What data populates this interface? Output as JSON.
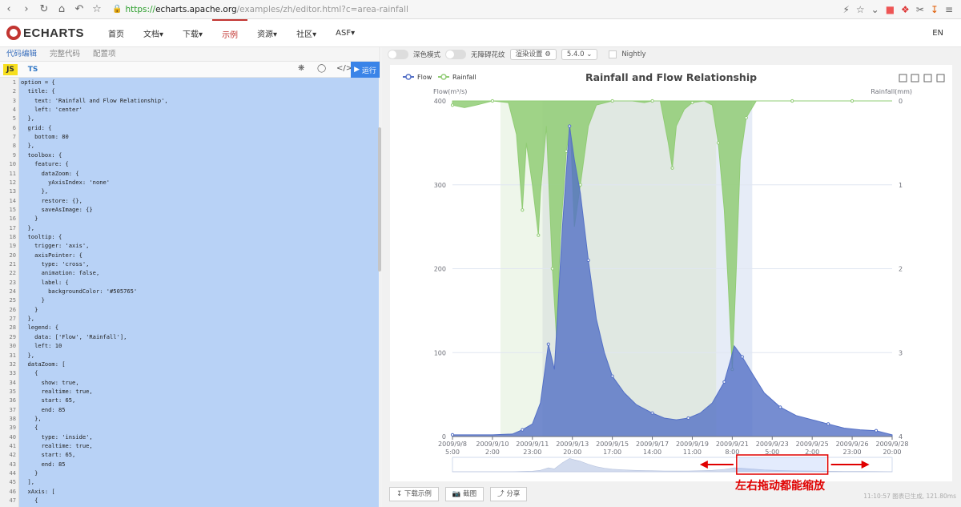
{
  "browser": {
    "url_scheme": "https://",
    "url_host": "echarts.apache.org",
    "url_path": "/examples/zh/editor.html?c=area-rainfall"
  },
  "site": {
    "brand": "ECHARTS",
    "nav": [
      "首页",
      "文档▾",
      "下载▾",
      "示例",
      "资源▾",
      "社区▾",
      "ASF▾"
    ],
    "lang": "EN"
  },
  "editor": {
    "tabs": [
      "代码编辑",
      "完整代码",
      "配置项"
    ],
    "js": "JS",
    "ts": "TS",
    "run": "运行",
    "code_lines": [
      "option = {",
      "  title: {",
      "    text: 'Rainfall and Flow Relationship',",
      "    left: 'center'",
      "  },",
      "  grid: {",
      "    bottom: 80",
      "  },",
      "  toolbox: {",
      "    feature: {",
      "      dataZoom: {",
      "        yAxisIndex: 'none'",
      "      },",
      "      restore: {},",
      "      saveAsImage: {}",
      "    }",
      "  },",
      "  tooltip: {",
      "    trigger: 'axis',",
      "    axisPointer: {",
      "      type: 'cross',",
      "      animation: false,",
      "      label: {",
      "        backgroundColor: '#505765'",
      "      }",
      "    }",
      "  },",
      "  legend: {",
      "    data: ['Flow', 'Rainfall'],",
      "    left: 10",
      "  },",
      "  dataZoom: [",
      "    {",
      "      show: true,",
      "      realtime: true,",
      "      start: 65,",
      "      end: 85",
      "    },",
      "    {",
      "      type: 'inside',",
      "      realtime: true,",
      "      start: 65,",
      "      end: 85",
      "    }",
      "  ],",
      "  xAxis: [",
      "    {"
    ]
  },
  "controls": {
    "dark": "深色模式",
    "noblur": "无障碍花纹",
    "render": "渲染设置 ⚙",
    "version": "5.4.0",
    "nightly": "Nightly"
  },
  "bottom": {
    "download": "下载示例",
    "screenshot": "截图",
    "share": "分享",
    "timestamp": "11:10:57  图表已生成, 121.80ms"
  },
  "annotation": "左右拖动都能缩放",
  "colors": {
    "flow": "#5470c6",
    "rainfall": "#91cc75",
    "accent": "#c23531",
    "mark1": "#f0f7ec",
    "mark2": "#e4ebe4",
    "mark3": "#e8edf7"
  },
  "chart_data": {
    "type": "area",
    "title": "Rainfall and Flow Relationship",
    "legend": [
      "Flow",
      "Rainfall"
    ],
    "yaxis_left": {
      "name": "Flow(m³/s)",
      "range": [
        0,
        400
      ],
      "ticks": [
        "0",
        "100",
        "200",
        "300",
        "400"
      ]
    },
    "yaxis_right": {
      "name": "Rainfall(mm)",
      "range": [
        0,
        4
      ],
      "inverse": true,
      "ticks": [
        "0",
        "1",
        "2",
        "3",
        "4"
      ]
    },
    "x_ticks": [
      "2009/9/8\n5:00",
      "2009/9/10\n2:00",
      "2009/9/11\n23:00",
      "2009/9/13\n20:00",
      "2009/9/15\n17:00",
      "2009/9/17\n14:00",
      "2009/9/19\n11:00",
      "2009/9/21\n8:00",
      "2009/9/23\n5:00",
      "2009/9/25\n2:00",
      "2009/9/26\n23:00",
      "2009/9/28\n20:00"
    ],
    "x_range": [
      0,
      11
    ],
    "series": [
      {
        "name": "Flow",
        "points": [
          [
            0,
            2
          ],
          [
            1,
            2
          ],
          [
            1.5,
            3
          ],
          [
            1.75,
            8
          ],
          [
            2,
            15
          ],
          [
            2.2,
            40
          ],
          [
            2.4,
            110
          ],
          [
            2.55,
            80
          ],
          [
            2.75,
            250
          ],
          [
            2.93,
            370
          ],
          [
            3.05,
            330
          ],
          [
            3.2,
            290
          ],
          [
            3.4,
            210
          ],
          [
            3.6,
            140
          ],
          [
            3.8,
            100
          ],
          [
            4,
            72
          ],
          [
            4.3,
            52
          ],
          [
            4.6,
            38
          ],
          [
            5,
            28
          ],
          [
            5.3,
            22
          ],
          [
            5.6,
            20
          ],
          [
            5.9,
            22
          ],
          [
            6.2,
            28
          ],
          [
            6.5,
            40
          ],
          [
            6.8,
            65
          ],
          [
            6.95,
            90
          ],
          [
            7.05,
            108
          ],
          [
            7.25,
            95
          ],
          [
            7.5,
            75
          ],
          [
            7.8,
            52
          ],
          [
            8.2,
            35
          ],
          [
            8.6,
            25
          ],
          [
            9,
            20
          ],
          [
            9.4,
            15
          ],
          [
            9.8,
            10
          ],
          [
            10.2,
            8
          ],
          [
            10.6,
            7
          ],
          [
            11,
            2
          ]
        ]
      },
      {
        "name": "Rainfall",
        "points": [
          [
            0,
            0.05
          ],
          [
            0.3,
            0.08
          ],
          [
            0.6,
            0.05
          ],
          [
            1,
            0
          ],
          [
            1.4,
            0.02
          ],
          [
            1.6,
            0.4
          ],
          [
            1.75,
            1.3
          ],
          [
            1.85,
            0.5
          ],
          [
            2,
            1.0
          ],
          [
            2.15,
            1.6
          ],
          [
            2.2,
            1.1
          ],
          [
            2.35,
            0.3
          ],
          [
            2.5,
            2.0
          ],
          [
            2.6,
            2.8
          ],
          [
            2.7,
            1.6
          ],
          [
            2.85,
            0.6
          ],
          [
            2.95,
            0.3
          ],
          [
            3.05,
            1.5
          ],
          [
            3.2,
            1.0
          ],
          [
            3.4,
            0.3
          ],
          [
            3.6,
            0.05
          ],
          [
            4,
            0
          ],
          [
            4.5,
            0
          ],
          [
            4.8,
            0.02
          ],
          [
            5,
            0
          ],
          [
            5.2,
            0
          ],
          [
            5.4,
            0.5
          ],
          [
            5.5,
            0.8
          ],
          [
            5.6,
            0.3
          ],
          [
            5.8,
            0.1
          ],
          [
            6,
            0.02
          ],
          [
            6.3,
            0
          ],
          [
            6.5,
            0.05
          ],
          [
            6.65,
            0.5
          ],
          [
            6.8,
            1.3
          ],
          [
            6.9,
            2.2
          ],
          [
            7,
            3.2
          ],
          [
            7.1,
            2.0
          ],
          [
            7.2,
            0.7
          ],
          [
            7.35,
            0.2
          ],
          [
            7.6,
            0
          ],
          [
            8,
            0
          ],
          [
            8.5,
            0
          ],
          [
            9,
            0
          ],
          [
            9.5,
            0
          ],
          [
            10,
            0
          ],
          [
            10.5,
            0
          ],
          [
            11,
            0
          ]
        ]
      }
    ],
    "mark_areas": [
      {
        "from": 1.2,
        "to": 2.25,
        "color": "#eef6ea"
      },
      {
        "from": 2.25,
        "to": 6.6,
        "color": "#e0e8e2"
      },
      {
        "from": 6.6,
        "to": 7.5,
        "color": "#e6ecf7"
      }
    ],
    "datazoom": {
      "start": 65,
      "end": 85
    }
  }
}
